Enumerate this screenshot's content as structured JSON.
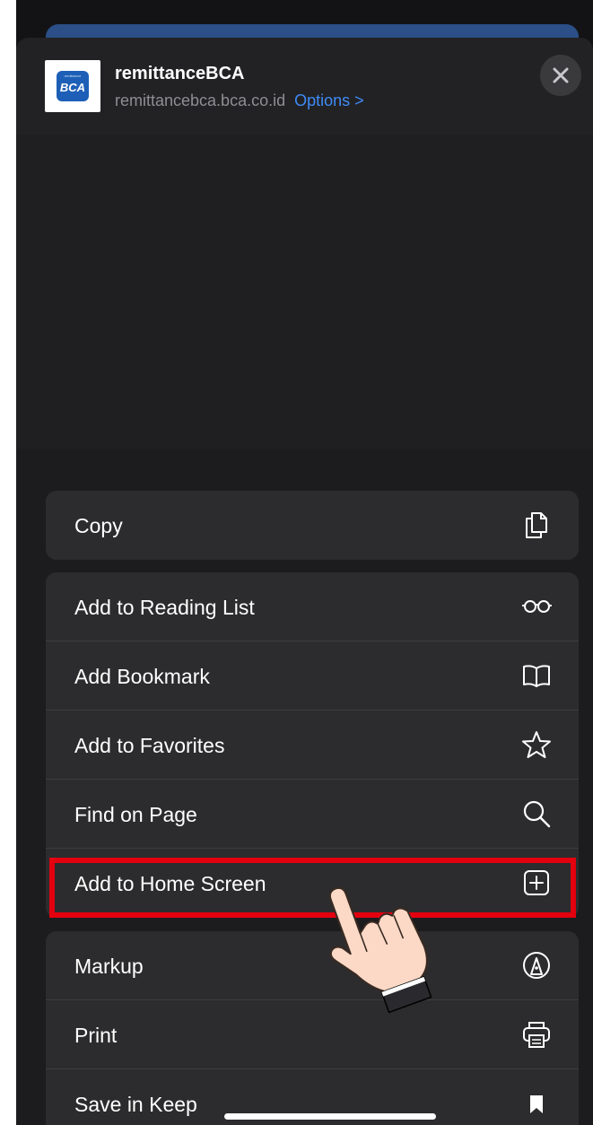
{
  "header": {
    "app_name": "remittanceBCA",
    "domain": "remittancebca.bca.co.id",
    "options_label": "Options >",
    "icon_small_text": "remittance",
    "icon_brand_text": "BCA"
  },
  "groups": [
    {
      "items": [
        {
          "label": "Copy",
          "icon": "copy-icon"
        }
      ]
    },
    {
      "items": [
        {
          "label": "Add to Reading List",
          "icon": "reading-glasses-icon"
        },
        {
          "label": "Add Bookmark",
          "icon": "book-icon"
        },
        {
          "label": "Add to Favorites",
          "icon": "star-icon"
        },
        {
          "label": "Find on Page",
          "icon": "search-icon"
        },
        {
          "label": "Add to Home Screen",
          "icon": "plus-square-icon"
        }
      ]
    },
    {
      "items": [
        {
          "label": "Markup",
          "icon": "markup-icon"
        },
        {
          "label": "Print",
          "icon": "printer-icon"
        },
        {
          "label": "Save in Keep",
          "icon": "bookmark-flag-icon"
        }
      ]
    }
  ],
  "colors": {
    "accent": "#3f8bf6",
    "highlight": "#e3000f",
    "sheet": "#1c1c1e",
    "row": "#2c2c2e"
  }
}
